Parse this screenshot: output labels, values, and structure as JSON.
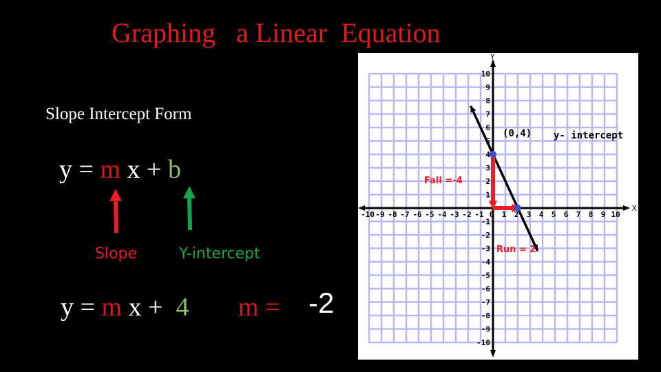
{
  "title": "Graphing   a Linear  Equation",
  "subtitle": "Slope Intercept Form",
  "general_equation": {
    "y": "y",
    "eq": " = ",
    "m": "m",
    "x": " x + ",
    "b": "b"
  },
  "labels": {
    "slope": "Slope",
    "y_intercept": "Y-intercept"
  },
  "specific_equation": {
    "y": "y",
    "eq": " = ",
    "m": "m",
    "x": " x +  ",
    "b": "4"
  },
  "slope_equation": {
    "m": "m",
    "eq": " = ",
    "value": "-2"
  },
  "colors": {
    "title": "#e11b1b",
    "slope": "#e11b2a",
    "intercept": "#16a34a",
    "grid": "#b7b7f5",
    "point": "#3c4fc9",
    "arrow_red": "#ee1c24"
  },
  "chart_data": {
    "type": "line",
    "xlabel": "X",
    "ylabel": "Y",
    "xlim": [
      -10,
      10
    ],
    "ylim": [
      -10,
      10
    ],
    "grid": true,
    "x_ticks": [
      "-10",
      "-9",
      "-8",
      "-7",
      "-6",
      "-5",
      "-4",
      "-3",
      "-2",
      "-1",
      "0",
      "1",
      "2",
      "3",
      "4",
      "5",
      "6",
      "7",
      "8",
      "9",
      "10"
    ],
    "y_ticks": [
      "10",
      "9",
      "8",
      "7",
      "6",
      "5",
      "4",
      "3",
      "2",
      "1",
      "-1",
      "-2",
      "-3",
      "-4",
      "-5",
      "-6",
      "-7",
      "-8",
      "-9",
      "-10"
    ],
    "line": {
      "slope": -2,
      "intercept": 4,
      "from": [
        -1.8,
        7.6
      ],
      "to": [
        3.6,
        -3.2
      ]
    },
    "points": [
      {
        "x": 0,
        "y": 4
      },
      {
        "x": 2,
        "y": 0
      }
    ],
    "rise_arrow": {
      "from": [
        0,
        4
      ],
      "to": [
        0,
        0
      ],
      "label": "Fall =-4"
    },
    "run_arrow": {
      "from": [
        0,
        0
      ],
      "to": [
        2,
        0
      ],
      "label": "Run = 2"
    },
    "annotations": {
      "point_label": "(0,4)",
      "intercept_label": "y- intercept"
    }
  }
}
